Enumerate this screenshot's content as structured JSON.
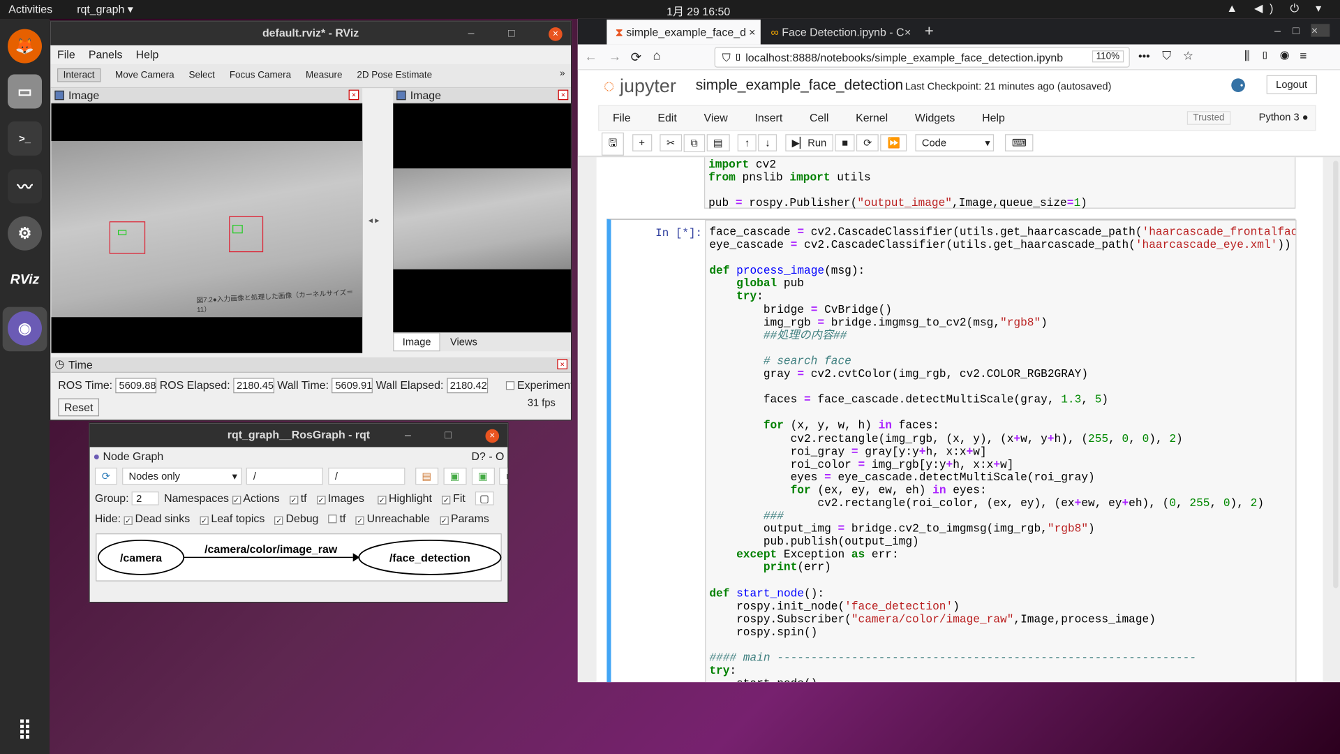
{
  "topbar": {
    "activities": "Activities",
    "app": "rqt_graph ▾",
    "clock": "1月 29  16:50",
    "sys": "▲ ◀) ⏻ ▾"
  },
  "dock": [
    {
      "name": "firefox-icon",
      "glyph": "🦊"
    },
    {
      "name": "files-icon",
      "glyph": "▭"
    },
    {
      "name": "terminal-icon",
      "glyph": ">_"
    },
    {
      "name": "system-monitor-icon",
      "glyph": "〰"
    },
    {
      "name": "settings-icon",
      "glyph": "⚙"
    },
    {
      "name": "rviz-icon",
      "glyph": "RViz"
    },
    {
      "name": "rqt-icon",
      "glyph": "◉"
    }
  ],
  "rviz": {
    "title": "default.rviz* - RViz",
    "menu": [
      "File",
      "Panels",
      "Help"
    ],
    "tools": [
      "Interact",
      "Move Camera",
      "Select",
      "Focus Camera",
      "Measure",
      "2D Pose Estimate"
    ],
    "more": "»",
    "image_panel_left": "Image",
    "image_panel_right": "Image",
    "right_tabs": [
      "Image",
      "Views"
    ],
    "time_panel": "Time",
    "ros_time_label": "ROS Time:",
    "ros_time": "5609.88",
    "ros_elapsed_label": "ROS Elapsed:",
    "ros_elapsed": "2180.45",
    "wall_time_label": "Wall Time:",
    "wall_time": "5609.91",
    "wall_elapsed_label": "Wall Elapsed:",
    "wall_elapsed": "2180.42",
    "experimental": "Experimental",
    "reset": "Reset",
    "fps": "31 fps",
    "caption": "図7.2●入力画像と処理した画像（カーネルサイズ＝11）"
  },
  "rqt": {
    "title": "rqt_graph__RosGraph - rqt",
    "plugin": "Node Graph",
    "plugin_ctl": "D? - O",
    "mode": "Nodes only",
    "filter1": "/",
    "filter2": "/",
    "group_label": "Group:",
    "group": "2",
    "row1": [
      "Namespaces",
      "Actions",
      "tf",
      "Images",
      "Highlight",
      "Fit"
    ],
    "hide_label": "Hide:",
    "row2": [
      "Dead sinks",
      "Leaf topics",
      "Debug",
      "tf",
      "Unreachable",
      "Params"
    ],
    "node_left": "/camera",
    "edge": "/camera/color/image_raw",
    "node_right": "/face_detection"
  },
  "browser": {
    "tab1": "simple_example_face_d",
    "tab2": "Face Detection.ipynb - C",
    "url": "localhost:8888/notebooks/simple_example_face_detection.ipynb",
    "zoom": "110%",
    "brand": "jupyter",
    "nb_title": "simple_example_face_detection",
    "checkpoint": "Last Checkpoint: 21 minutes ago",
    "autosaved": "(autosaved)",
    "logout": "Logout",
    "menus": [
      "File",
      "Edit",
      "View",
      "Insert",
      "Cell",
      "Kernel",
      "Widgets",
      "Help"
    ],
    "trusted": "Trusted",
    "kernel": "Python 3",
    "run": "Run",
    "cell_type": "Code",
    "prompt": "In [*]:"
  },
  "accent": "#e95420"
}
